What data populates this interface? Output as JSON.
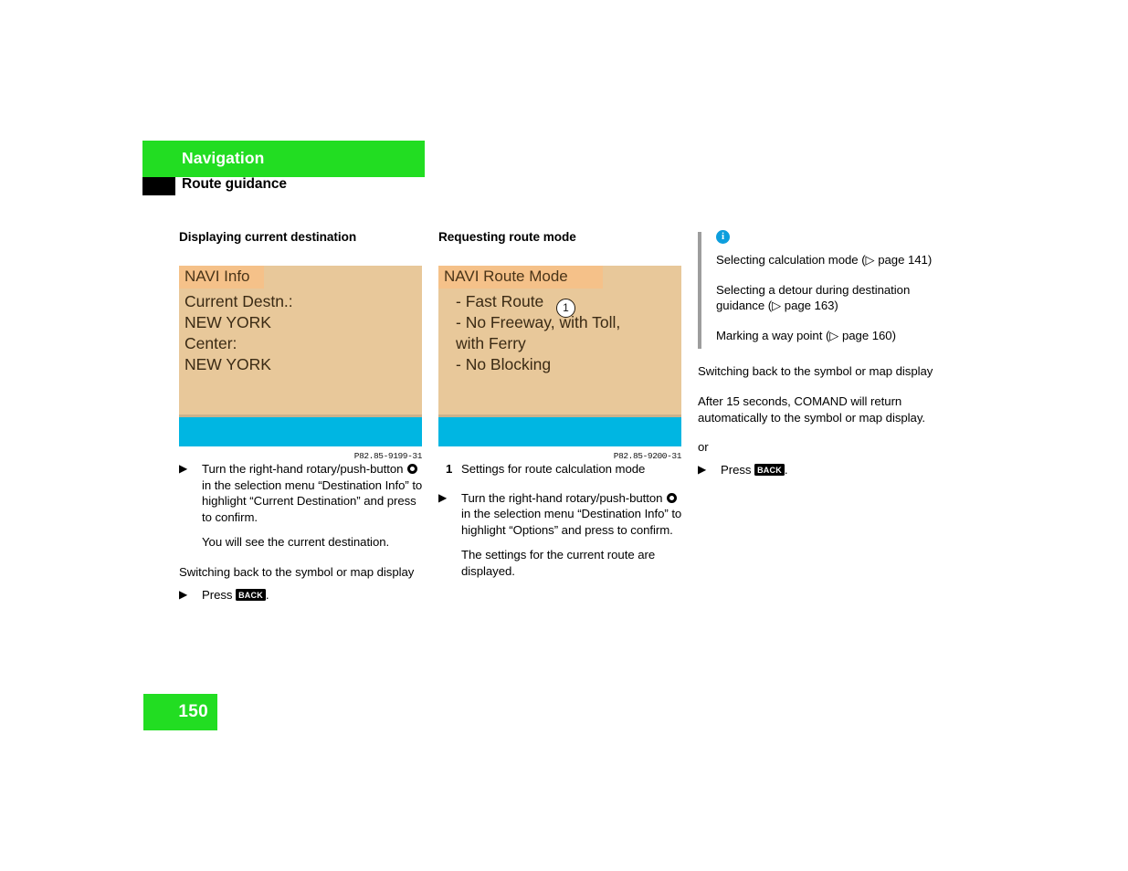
{
  "header": {
    "chapter": "Navigation",
    "section": "Route guidance"
  },
  "columns": {
    "left": {
      "heading": "Displaying current destination",
      "figure": {
        "screen_title": "NAVI Info",
        "screen_lines": [
          "Current Destn.:",
          "NEW YORK",
          "Center:",
          "NEW YORK"
        ],
        "caption": "P82.85-9199-31"
      },
      "step_1_part_a": "Turn the right-hand rotary/push-button",
      "step_1_part_b": "in the selection menu “Destination Info” to highlight “Current Destination” and press to confirm.",
      "result": "You will see the current destination.",
      "switch_back_heading": "Switching back to the symbol or map display",
      "press_label": "Press",
      "back_key": "BACK",
      "period": "."
    },
    "middle": {
      "heading": "Requesting route mode",
      "figure": {
        "screen_title": "NAVI Route Mode",
        "screen_lines": [
          "- Fast Route",
          "- No Freeway, with Toll,",
          "  with Ferry",
          "- No Blocking"
        ],
        "callout_number": "1",
        "caption": "P82.85-9200-31"
      },
      "legend_number": "1",
      "legend_text": "Settings for route calculation mode",
      "step_1_part_a": "Turn the right-hand rotary/push-button",
      "step_1_part_b": "in the selection menu “Destination Info” to highlight “Options” and press to confirm.",
      "result": "The settings for the current route are displayed."
    },
    "right": {
      "info_icon_glyph": "i",
      "info_items": [
        "Selecting calculation mode (▷ page 141)",
        "Selecting a detour during destination guidance (▷ page 163)",
        "Marking a way point (▷ page 160)"
      ],
      "switch_back_heading": "Switching back to the symbol or map display",
      "auto_return_text": "After 15 seconds, COMAND will return automatically to the symbol or map display.",
      "or_label": "or",
      "press_label": "Press",
      "back_key": "BACK",
      "period": "."
    }
  },
  "footer": {
    "page_number": "150"
  },
  "colors": {
    "chapter_green": "#22dd22",
    "screen_background": "#e8c89a",
    "screen_title_band": "#f5c189",
    "screen_bottom_band": "#00b6e2",
    "info_icon_blue": "#0d9edd",
    "info_rule_gray": "#9d9d9d"
  }
}
